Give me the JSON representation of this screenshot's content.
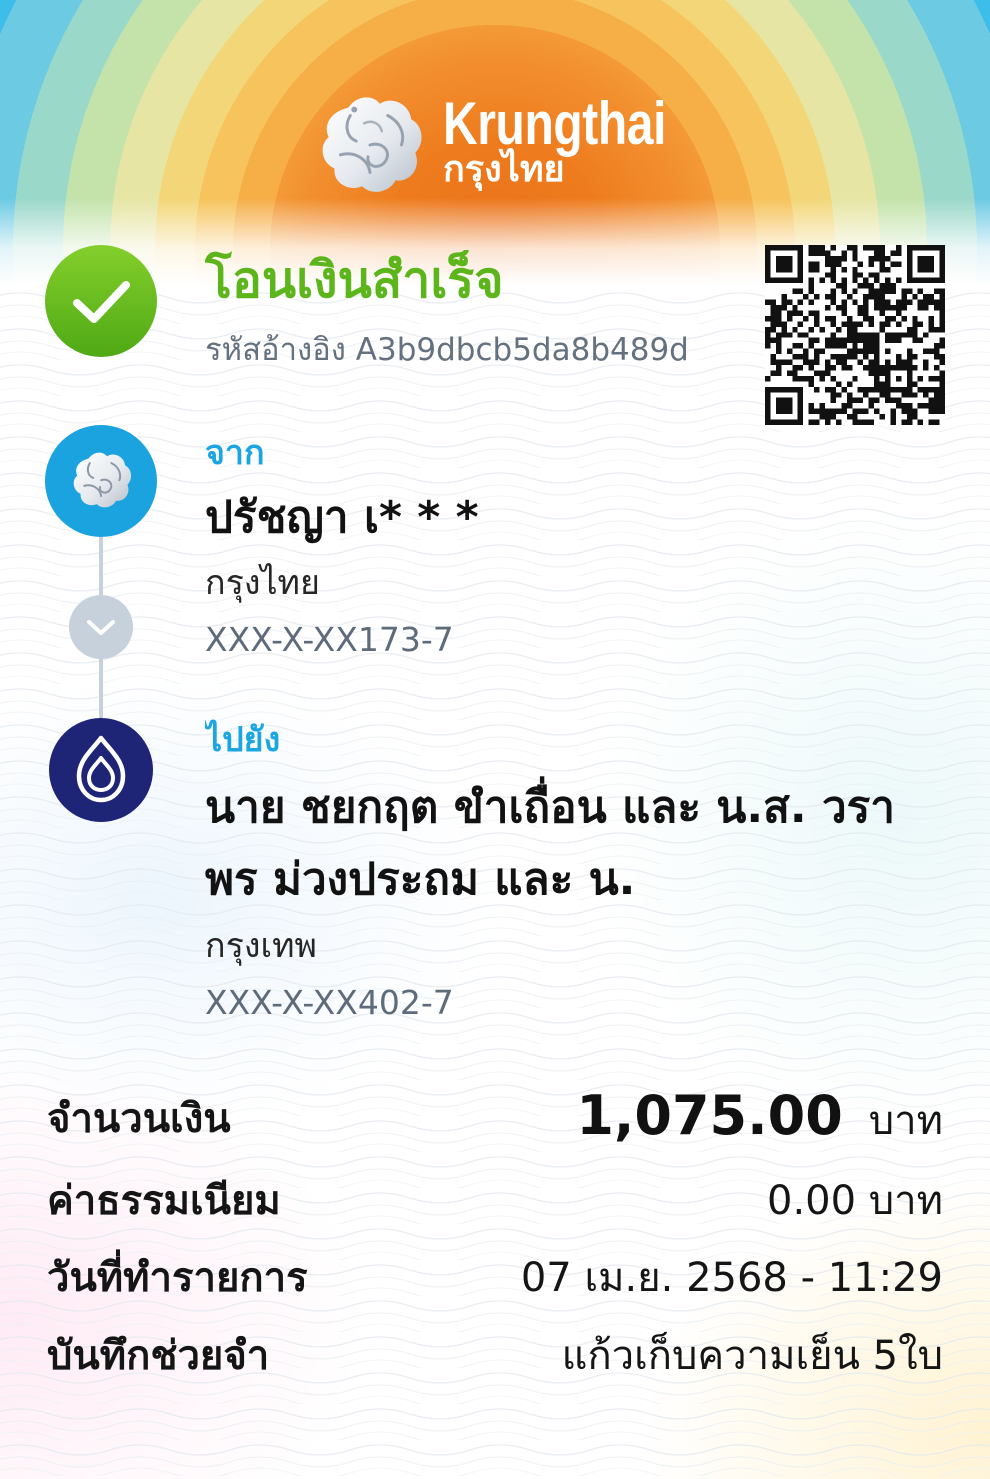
{
  "header": {
    "logo_icon": "krungthai-bird-icon",
    "brand_en": "Krungthai",
    "brand_th": "กรุงไทย"
  },
  "status": {
    "icon": "check-icon",
    "title": "โอนเงินสำเร็จ",
    "reference_label": "รหัสอ้างอิง",
    "reference_code": "A3b9dbcb5da8b489d"
  },
  "qr_code": {
    "icon": "qr-code-icon"
  },
  "sender": {
    "bank_icon": "krungthai-bird-icon",
    "label": "จาก",
    "name": "ปรัชญา เ* * *",
    "bank": "กรุงไทย",
    "account": "XXX-X-XX173-7"
  },
  "connector_icon": "chevron-down-icon",
  "recipient": {
    "bank_icon": "bangkok-bank-lotus-icon",
    "label": "ไปยัง",
    "name_lines": [
      "นาย ชยกฤต ขำเถื่อน และ น.ส. วรา",
      "พร ม่วงประถม และ น."
    ],
    "bank": "กรุงเทพ",
    "account": "XXX-X-XX402-7"
  },
  "details": {
    "amount": {
      "label": "จำนวนเงิน",
      "value": "1,075.00",
      "unit": "บาท"
    },
    "fee": {
      "label": "ค่าธรรมเนียม",
      "value": "0.00 บาท"
    },
    "date": {
      "label": "วันที่ทำรายการ",
      "value": "07 เม.ย. 2568 - 11:29"
    },
    "memo": {
      "label": "บันทึกช่วยจำ",
      "value": "แก้วเก็บความเย็น 5ใบ"
    }
  },
  "colors": {
    "green": "#5cb51b",
    "blue": "#1ba5e1",
    "ktb": "#1aa3df",
    "navy": "#1e2577",
    "muted": "#5d6b7b",
    "conn": "#c6d1db"
  }
}
